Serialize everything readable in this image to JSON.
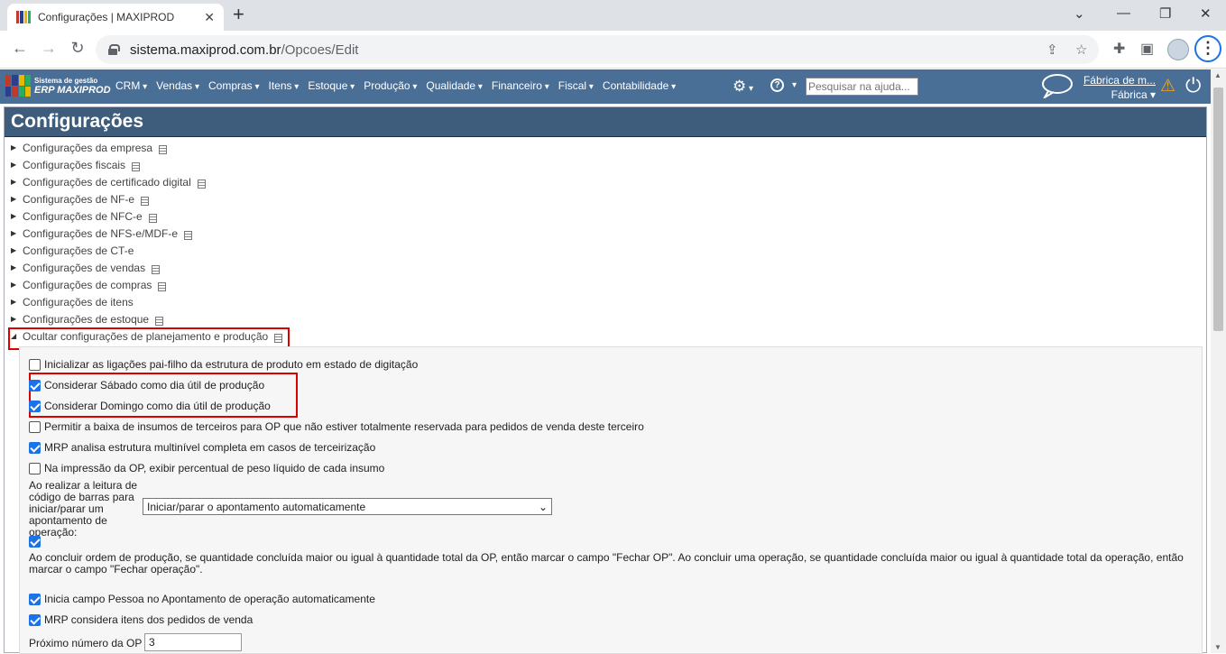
{
  "browser": {
    "tab_title": "Configurações | MAXIPROD",
    "close_tab": "✕",
    "new_tab": "+",
    "url_host": "sistema.maxiprod.com.br",
    "url_path": "/Opcoes/Edit",
    "window_controls": {
      "minimize": "—",
      "restore": "❐",
      "close": "✕"
    }
  },
  "app_nav": {
    "logo_line1": "Sistema de gestão",
    "logo_line2": "ERP MAXIPROD",
    "menus": [
      "CRM",
      "Vendas",
      "Compras",
      "Itens",
      "Estoque",
      "Produção",
      "Qualidade",
      "Financeiro",
      "Fiscal",
      "Contabilidade"
    ],
    "search_placeholder": "Pesquisar na ajuda...",
    "company_name": "Fábrica de m...",
    "company_unit": "Fábrica ▾"
  },
  "page": {
    "title": "Configurações",
    "sections": [
      "Configurações da empresa",
      "Configurações fiscais",
      "Configurações de certificado digital",
      "Configurações de NF-e",
      "Configurações de NFC-e",
      "Configurações de NFS-e/MDF-e",
      "Configurações de CT-e",
      "Configurações de vendas",
      "Configurações de compras",
      "Configurações de itens",
      "Configurações de estoque"
    ],
    "open_section": "Ocultar configurações de planejamento e produção",
    "options": {
      "opt1": "Inicializar as ligações pai-filho da estrutura de produto em estado de digitação",
      "opt2": "Considerar Sábado como dia útil de produção",
      "opt3": "Considerar Domingo como dia útil de produção",
      "opt4": "Permitir a baixa de insumos de terceiros para OP que não estiver totalmente reservada para pedidos de venda deste terceiro",
      "opt5": "MRP analisa estrutura multinível completa em casos de terceirização",
      "opt6": "Na impressão da OP, exibir percentual de peso líquido de cada insumo",
      "barcode_label": "Ao realizar a leitura de código de barras para iniciar/parar um apontamento de operação:",
      "barcode_value": "Iniciar/parar o apontamento automaticamente",
      "opt7": "Ao concluir ordem de produção, se quantidade concluída maior ou igual à quantidade total da OP, então marcar o campo \"Fechar OP\". Ao concluir uma operação, se quantidade concluída maior ou igual à quantidade total da operação, então marcar o campo \"Fechar operação\".",
      "opt8": "Inicia campo Pessoa no Apontamento de operação automaticamente",
      "opt9": "MRP considera itens dos pedidos de venda",
      "next_op_label": "Próximo número da OP",
      "next_op_value": "3"
    }
  }
}
